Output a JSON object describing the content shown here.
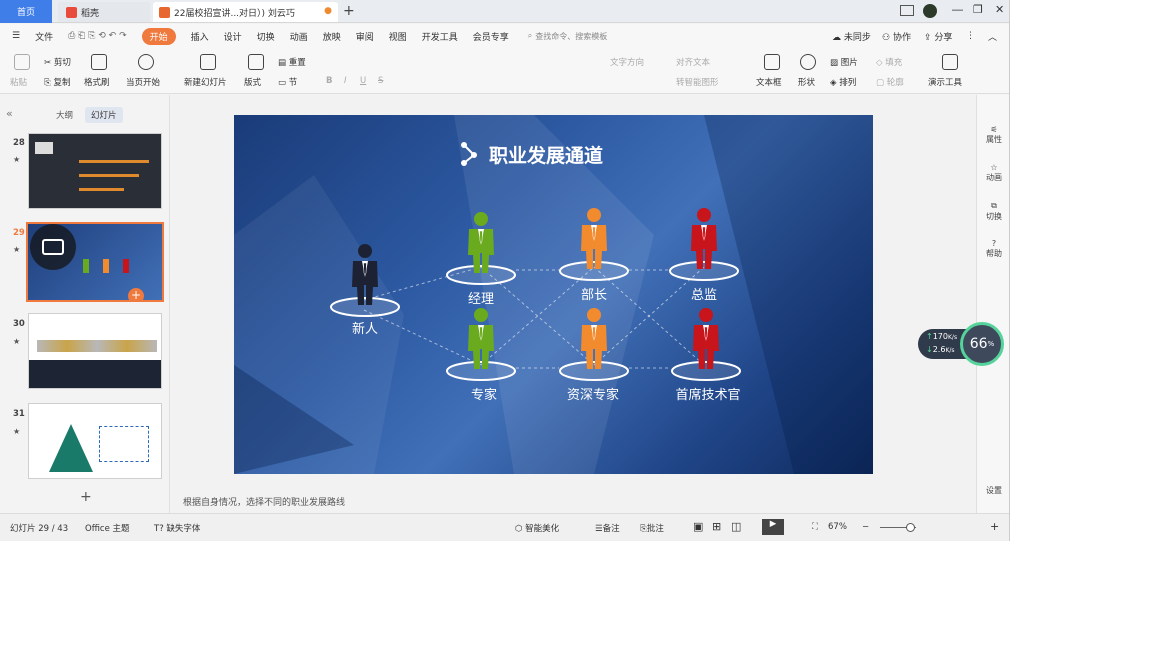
{
  "titlebar": {
    "home_tab": "首页",
    "daoke_tab": "稻壳",
    "doc_tab": "22届校招宣讲...对日）) 刘云巧",
    "new_tab": "+",
    "win_controls": [
      "―",
      "❐",
      "✕"
    ]
  },
  "menubar": {
    "file": "文件",
    "items": [
      "开始",
      "插入",
      "设计",
      "切换",
      "动画",
      "放映",
      "审阅",
      "视图",
      "开发工具",
      "会员专享"
    ],
    "search_placeholder": "查找命令、搜索模板",
    "sync": "未同步",
    "collab": "协作",
    "share": "分享"
  },
  "ribbon": {
    "paste": "粘贴",
    "cut": "剪切",
    "copy": "复制",
    "format_painter": "格式刷",
    "play_from_current": "当页开始",
    "new_slide": "新建幻灯片",
    "layout": "版式",
    "reset": "重置",
    "section": "节",
    "bold": "B",
    "italic": "I",
    "underline": "U",
    "strike": "S",
    "text_direction": "文字方向",
    "smart_graphic": "转智能图形",
    "align_text": "对齐文本",
    "textbox": "文本框",
    "shape": "形状",
    "picture": "图片",
    "arrange": "排列",
    "fill": "填充",
    "outline": "轮廓",
    "present_tools": "演示工具"
  },
  "leftpanel": {
    "outline_tab": "大纲",
    "slides_tab": "幻灯片",
    "slide_numbers": [
      "28",
      "29",
      "30",
      "31"
    ],
    "star": "★",
    "add_slide": "+"
  },
  "slide": {
    "title": "职业发展通道",
    "people": {
      "newcomer": "新人",
      "manager": "经理",
      "minister": "部长",
      "director": "总监",
      "expert": "专家",
      "senior_expert": "资深专家",
      "chief_tech": "首席技术官"
    },
    "colors": {
      "newcomer": "#1c2233",
      "green": "#6aaa1e",
      "orange": "#f28a2e",
      "red": "#c8141b"
    }
  },
  "notes": "根据自身情况，选择不同的职业发展路线",
  "rightbar": {
    "properties": "属性",
    "animation": "动画",
    "transition": "切换",
    "help": "帮助",
    "settings": "设置"
  },
  "speed": {
    "up": "170",
    "down": "2.6",
    "unit": "K/s",
    "percent": "66",
    "percent_sign": "%"
  },
  "statusbar": {
    "slide_info": "幻灯片 29 / 43",
    "theme": "Office 主题",
    "missing_font": "缺失字体",
    "beautify": "智能美化",
    "notes": "备注",
    "comment": "批注",
    "zoom": "67%",
    "minus": "−",
    "plus": "+"
  }
}
